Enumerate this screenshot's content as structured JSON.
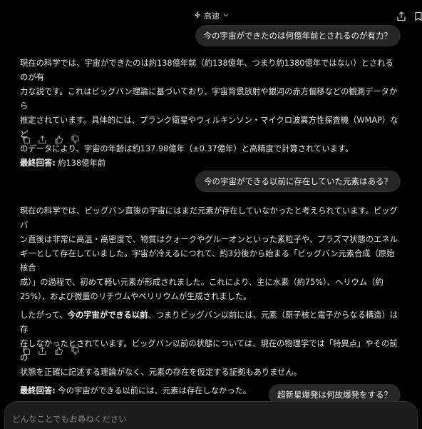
{
  "header": {
    "model_label": "高速",
    "share_icon": "share-icon",
    "bookmark_icon": "bookmark-icon",
    "speed_icon": "lightning-icon"
  },
  "conversation": [
    {
      "user": "今の宇宙ができたのは何億年前とされるのが有力？",
      "assistant": {
        "lines": [
          "現在の科学では、宇宙ができたのは約138億年前（約138億年、つまり約1380億年ではない）とされるのが有",
          "力な説です。これはビッグバン理論に基づいており、宇宙背景放射や銀河の赤方偏移などの観測データから",
          "推定されています。具体的には、プランク衛星やウィルキンソン・マイクロ波異方性探査機（WMAP）など",
          "のデータにより、宇宙の年齢は約137.98億年（±0.37億年）と高精度で計算されています。"
        ],
        "final_label": "最終回答:",
        "final_text": " 約138億年前"
      }
    },
    {
      "user": "今の宇宙ができる以前に存在していた元素はある？",
      "assistant": {
        "para1": [
          "現在の科学では、ビッグバン直後の宇宙にはまだ元素が存在していなかったと考えられています。ビッグバ",
          "ン直後は非常に高温・高密度で、物質はクォークやグルーオンといった素粒子や、プラズマ状態のエネル",
          "ギーとして存在していました。宇宙が冷えるにつれて、約3分後から始まる「ビッグバン元素合成（原始核合",
          "成）」の過程で、初めて軽い元素が形成されました。これにより、主に水素（約75%）、ヘリウム（約",
          "25%）、および微量のリチウムやベリリウムが生成されました。"
        ],
        "para2_prefix": "したがって、",
        "para2_bold": "今の宇宙ができる以前",
        "para2_line1_rest": "、つまりビッグバン以前には、元素（原子核と電子からなる構造）は存",
        "para2_lines": [
          "在しなかったとされています。ビッグバン以前の状態については、現在の物理学では「特異点」やその前の",
          "状態を正確に記述する理論がなく、元素の存在を仮定する証拠もありません。"
        ],
        "final_label": "最終回答:",
        "final_text": " 今の宇宙ができる以前には、元素は存在しなかった。"
      }
    },
    {
      "user": "超新星爆発は何故爆発をする？"
    }
  ],
  "composer": {
    "placeholder": "どんなことでもお尋ねください"
  }
}
